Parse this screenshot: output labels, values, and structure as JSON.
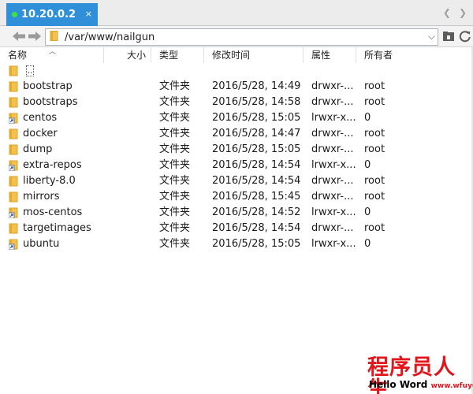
{
  "tab": {
    "title": "10.20.0.2",
    "close": "×"
  },
  "tab_nav": {
    "prev": "❮",
    "next": "❯"
  },
  "toolbar": {
    "path": "/var/www/nailgun",
    "dropdown": "⌵"
  },
  "columns": {
    "name": "名称",
    "size": "大小",
    "type": "类型",
    "modified": "修改时间",
    "attributes": "属性",
    "owner": "所有者"
  },
  "updir": {
    "label": ".."
  },
  "files": [
    {
      "name": "bootstrap",
      "kind": "folder",
      "type": "文件夹",
      "modified": "2016/5/28, 14:49",
      "attr": "drwxr-...",
      "owner": "root"
    },
    {
      "name": "bootstraps",
      "kind": "folder",
      "type": "文件夹",
      "modified": "2016/5/28, 14:58",
      "attr": "drwxr-...",
      "owner": "root"
    },
    {
      "name": "centos",
      "kind": "link",
      "type": "文件夹",
      "modified": "2016/5/28, 15:05",
      "attr": "lrwxr-x...",
      "owner": "0"
    },
    {
      "name": "docker",
      "kind": "folder",
      "type": "文件夹",
      "modified": "2016/5/28, 14:47",
      "attr": "drwxr-...",
      "owner": "root"
    },
    {
      "name": "dump",
      "kind": "folder",
      "type": "文件夹",
      "modified": "2016/5/28, 15:05",
      "attr": "drwxr-...",
      "owner": "root"
    },
    {
      "name": "extra-repos",
      "kind": "link",
      "type": "文件夹",
      "modified": "2016/5/28, 14:54",
      "attr": "lrwxr-x...",
      "owner": "0"
    },
    {
      "name": "liberty-8.0",
      "kind": "folder",
      "type": "文件夹",
      "modified": "2016/5/28, 14:54",
      "attr": "drwxr-...",
      "owner": "root"
    },
    {
      "name": "mirrors",
      "kind": "folder",
      "type": "文件夹",
      "modified": "2016/5/28, 15:45",
      "attr": "drwxr-...",
      "owner": "root"
    },
    {
      "name": "mos-centos",
      "kind": "link",
      "type": "文件夹",
      "modified": "2016/5/28, 14:52",
      "attr": "lrwxr-x...",
      "owner": "0"
    },
    {
      "name": "targetimages",
      "kind": "folder",
      "type": "文件夹",
      "modified": "2016/5/28, 14:54",
      "attr": "drwxr-...",
      "owner": "root"
    },
    {
      "name": "ubuntu",
      "kind": "link",
      "type": "文件夹",
      "modified": "2016/5/28, 15:05",
      "attr": "lrwxr-x...",
      "owner": "0"
    }
  ],
  "icons": {
    "folder": "folder-icon",
    "link": "folder-link-icon",
    "back": "back-arrow-icon",
    "forward": "forward-arrow-icon",
    "refresh": "refresh-icon",
    "bookmark": "bookmark-icon"
  },
  "colors": {
    "tab_active": "#2f8fd8",
    "status_dot": "#3ee53e",
    "folder": "#f2c14e",
    "watermark": "#e2151b"
  },
  "watermark": {
    "cn": "程序员人生",
    "en": "Hello Word",
    "url": "www.wfuyu.com"
  }
}
